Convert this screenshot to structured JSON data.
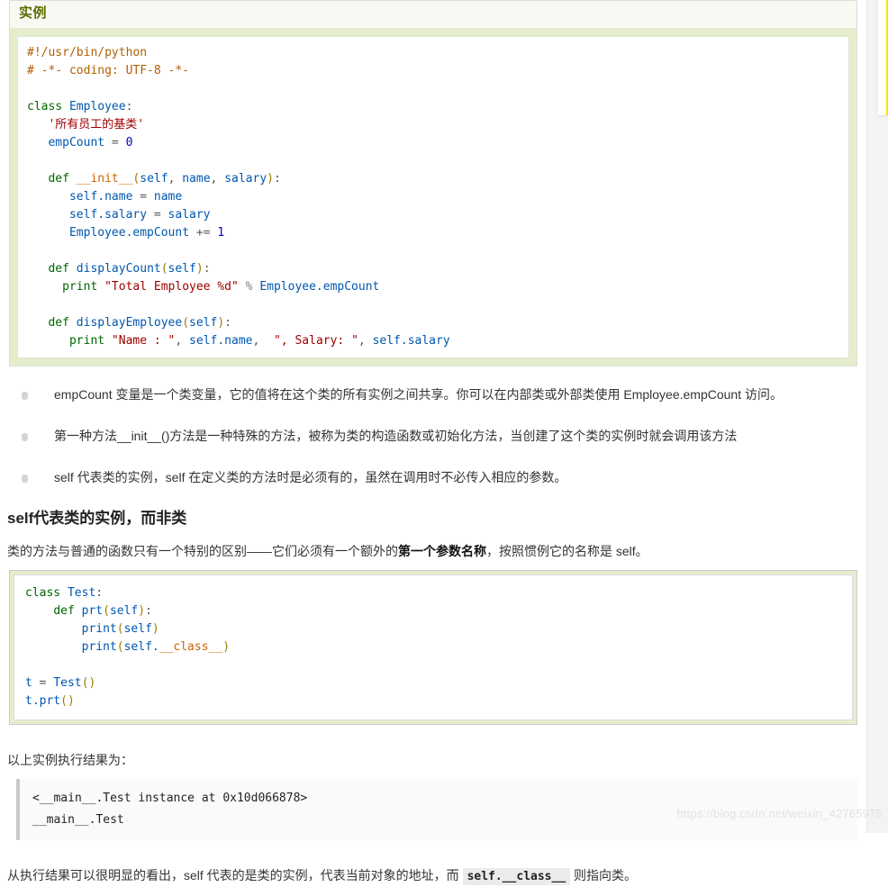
{
  "example_box": {
    "title": "实例",
    "code_lines": [
      [
        {
          "t": "#!/usr/bin/python",
          "c": "cm"
        }
      ],
      [
        {
          "t": "# -*- coding: UTF-8 -*-",
          "c": "cm"
        }
      ],
      [
        {
          "t": "",
          "c": ""
        }
      ],
      [
        {
          "t": "class ",
          "c": "k"
        },
        {
          "t": "Employee",
          "c": "cls"
        },
        {
          "t": ":",
          "c": "ar"
        }
      ],
      [
        {
          "t": "   '所有员工的基类'",
          "c": "st"
        }
      ],
      [
        {
          "t": "   ",
          "c": ""
        },
        {
          "t": "empCount",
          "c": "nm"
        },
        {
          "t": " = ",
          "c": "ar"
        },
        {
          "t": "0",
          "c": "num"
        }
      ],
      [
        {
          "t": "",
          "c": ""
        }
      ],
      [
        {
          "t": "   ",
          "c": ""
        },
        {
          "t": "def ",
          "c": "k"
        },
        {
          "t": "__init__",
          "c": "fn"
        },
        {
          "t": "(",
          "c": "pn"
        },
        {
          "t": "self",
          "c": "nm"
        },
        {
          "t": ", ",
          "c": "ar"
        },
        {
          "t": "name",
          "c": "nm"
        },
        {
          "t": ", ",
          "c": "ar"
        },
        {
          "t": "salary",
          "c": "nm"
        },
        {
          "t": ")",
          "c": "pn"
        },
        {
          "t": ":",
          "c": "ar"
        }
      ],
      [
        {
          "t": "      ",
          "c": ""
        },
        {
          "t": "self.name",
          "c": "nm"
        },
        {
          "t": " = ",
          "c": "ar"
        },
        {
          "t": "name",
          "c": "nm"
        }
      ],
      [
        {
          "t": "      ",
          "c": ""
        },
        {
          "t": "self.salary",
          "c": "nm"
        },
        {
          "t": " = ",
          "c": "ar"
        },
        {
          "t": "salary",
          "c": "nm"
        }
      ],
      [
        {
          "t": "      ",
          "c": ""
        },
        {
          "t": "Employee.empCount",
          "c": "nm"
        },
        {
          "t": " += ",
          "c": "ar"
        },
        {
          "t": "1",
          "c": "num"
        }
      ],
      [
        {
          "t": "",
          "c": ""
        }
      ],
      [
        {
          "t": "   ",
          "c": ""
        },
        {
          "t": "def ",
          "c": "k"
        },
        {
          "t": "displayCount",
          "c": "fn2"
        },
        {
          "t": "(",
          "c": "pn"
        },
        {
          "t": "self",
          "c": "nm"
        },
        {
          "t": ")",
          "c": "pn"
        },
        {
          "t": ":",
          "c": "ar"
        }
      ],
      [
        {
          "t": "     ",
          "c": ""
        },
        {
          "t": "print ",
          "c": "k"
        },
        {
          "t": "\"Total Employee %d\"",
          "c": "st"
        },
        {
          "t": " % ",
          "c": "op"
        },
        {
          "t": "Employee.empCount",
          "c": "nm"
        }
      ],
      [
        {
          "t": "",
          "c": ""
        }
      ],
      [
        {
          "t": "   ",
          "c": ""
        },
        {
          "t": "def ",
          "c": "k"
        },
        {
          "t": "displayEmployee",
          "c": "fn2"
        },
        {
          "t": "(",
          "c": "pn"
        },
        {
          "t": "self",
          "c": "nm"
        },
        {
          "t": ")",
          "c": "pn"
        },
        {
          "t": ":",
          "c": "ar"
        }
      ],
      [
        {
          "t": "      ",
          "c": ""
        },
        {
          "t": "print ",
          "c": "k"
        },
        {
          "t": "\"Name : \"",
          "c": "st"
        },
        {
          "t": ", ",
          "c": "ar"
        },
        {
          "t": "self.name",
          "c": "nm"
        },
        {
          "t": ",  ",
          "c": "ar"
        },
        {
          "t": "\", Salary: \"",
          "c": "st"
        },
        {
          "t": ", ",
          "c": "ar"
        },
        {
          "t": "self.salary",
          "c": "nm"
        }
      ]
    ]
  },
  "bullets": [
    "empCount 变量是一个类变量，它的值将在这个类的所有实例之间共享。你可以在内部类或外部类使用 Employee.empCount 访问。",
    "第一种方法__init__()方法是一种特殊的方法，被称为类的构造函数或初始化方法，当创建了这个类的实例时就会调用该方法",
    "self 代表类的实例，self 在定义类的方法时是必须有的，虽然在调用时不必传入相应的参数。"
  ],
  "section": {
    "heading": "self代表类的实例，而非类",
    "para_before": "类的方法与普通的函数只有一个特别的区别——它们必须有一个额外的",
    "para_bold": "第一个参数名称",
    "para_after": "，按照惯例它的名称是 self。"
  },
  "test_code": {
    "lines": [
      [
        {
          "t": "class ",
          "c": "k"
        },
        {
          "t": "Test",
          "c": "cls"
        },
        {
          "t": ":",
          "c": "ar"
        }
      ],
      [
        {
          "t": "    ",
          "c": ""
        },
        {
          "t": "def ",
          "c": "k"
        },
        {
          "t": "prt",
          "c": "fn2"
        },
        {
          "t": "(",
          "c": "pn"
        },
        {
          "t": "self",
          "c": "nm"
        },
        {
          "t": ")",
          "c": "pn"
        },
        {
          "t": ":",
          "c": "ar"
        }
      ],
      [
        {
          "t": "        ",
          "c": ""
        },
        {
          "t": "print",
          "c": "fn2"
        },
        {
          "t": "(",
          "c": "pn"
        },
        {
          "t": "self",
          "c": "nm"
        },
        {
          "t": ")",
          "c": "pn"
        }
      ],
      [
        {
          "t": "        ",
          "c": ""
        },
        {
          "t": "print",
          "c": "fn2"
        },
        {
          "t": "(",
          "c": "pn"
        },
        {
          "t": "self.",
          "c": "nm"
        },
        {
          "t": "__class__",
          "c": "fn"
        },
        {
          "t": ")",
          "c": "pn"
        }
      ],
      [
        {
          "t": "",
          "c": ""
        }
      ],
      [
        {
          "t": "t",
          "c": "nm"
        },
        {
          "t": " = ",
          "c": "ar"
        },
        {
          "t": "Test",
          "c": "nm"
        },
        {
          "t": "()",
          "c": "pn"
        }
      ],
      [
        {
          "t": "t.prt",
          "c": "nm"
        },
        {
          "t": "()",
          "c": "pn"
        }
      ]
    ]
  },
  "result": {
    "intro": "以上实例执行结果为：",
    "output": "<__main__.Test instance at 0x10d066878>\n__main__.Test"
  },
  "conclusion": {
    "before": "从执行结果可以很明显的看出，self 代表的是类的实例，代表当前对象的地址，而 ",
    "code": "self.__class__",
    "after": " 则指向类。"
  },
  "watermark": "https://blog.csdn.net/weixin_42765975",
  "colors": {
    "example_bg": "#e5eecc",
    "example_title": "#5b6e00",
    "keyword": "#006600",
    "string": "#a00000",
    "comment": "#b06000",
    "name": "#0057ae",
    "rail_accent": "#ffe400"
  }
}
